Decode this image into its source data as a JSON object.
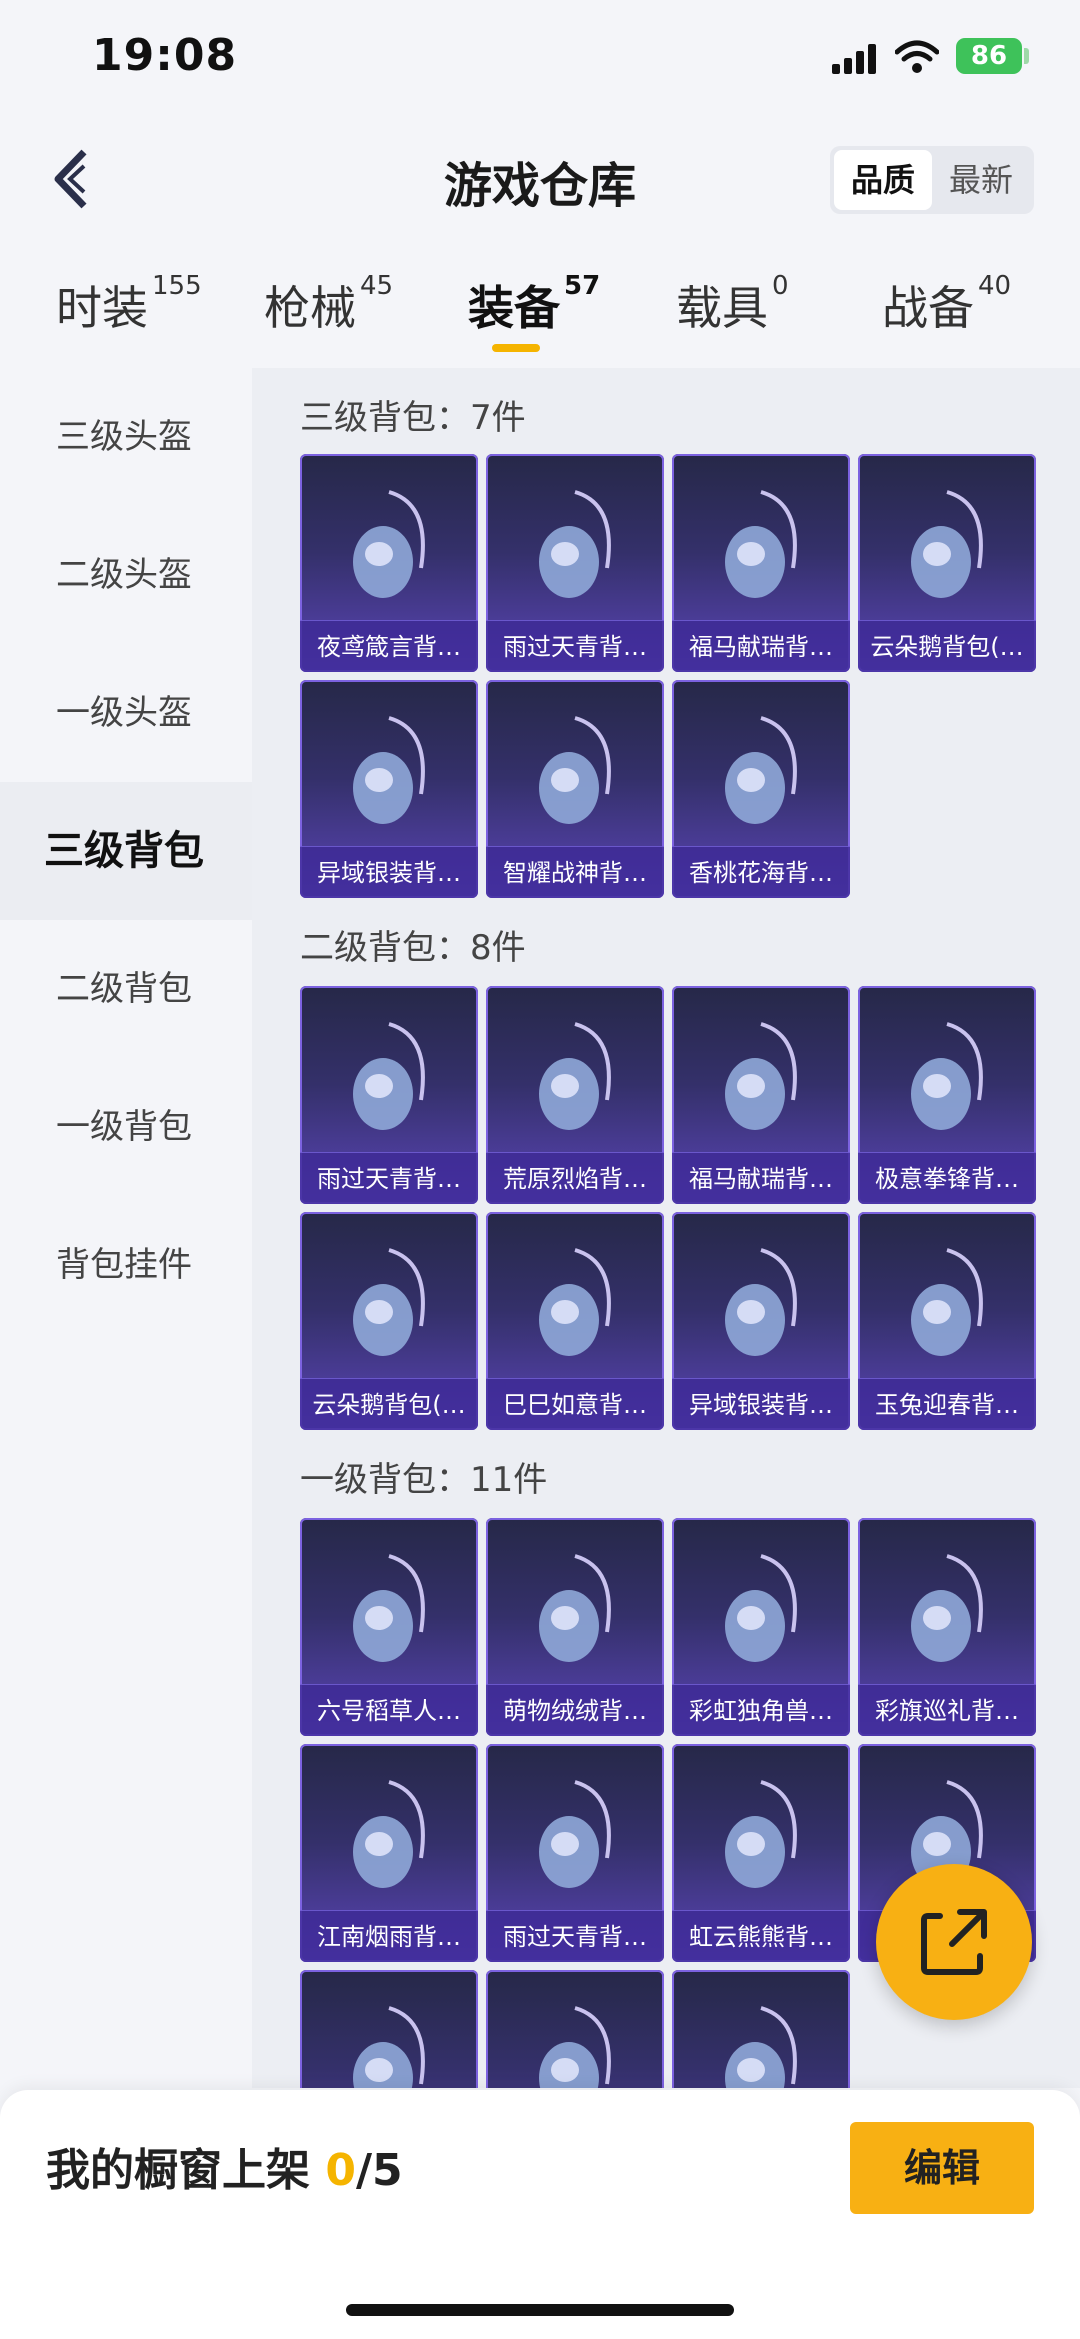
{
  "status_bar": {
    "time": "19:08",
    "battery": "86"
  },
  "header": {
    "title": "游戏仓库",
    "sort_options": [
      "品质",
      "最新"
    ]
  },
  "tabs": [
    {
      "label": "时装",
      "count": "155"
    },
    {
      "label": "枪械",
      "count": "45"
    },
    {
      "label": "装备",
      "count": "57"
    },
    {
      "label": "载具",
      "count": "0"
    },
    {
      "label": "战备",
      "count": "40"
    }
  ],
  "sidebar": {
    "items": [
      "三级头盔",
      "二级头盔",
      "一级头盔",
      "三级背包",
      "二级背包",
      "一级背包",
      "背包挂件"
    ]
  },
  "sections": [
    {
      "title": "三级背包：7件",
      "items": [
        "夜鸢箴言背…",
        "雨过天青背…",
        "福马献瑞背…",
        "云朵鹅背包(…",
        "异域银装背…",
        "智耀战神背…",
        "香桃花海背…"
      ]
    },
    {
      "title": "二级背包：8件",
      "items": [
        "雨过天青背…",
        "荒原烈焰背…",
        "福马献瑞背…",
        "极意拳锋背…",
        "云朵鹅背包(…",
        "巳巳如意背…",
        "异域银装背…",
        "玉兔迎春背…"
      ]
    },
    {
      "title": "一级背包：11件",
      "items": [
        "六号稻草人…",
        "萌物绒绒背…",
        "彩虹独角兽…",
        "彩旗巡礼背…",
        "江南烟雨背…",
        "雨过天青背…",
        "虹云熊熊背…",
        "",
        "",
        "",
        ""
      ]
    }
  ],
  "bottom": {
    "shelf_prefix": "我的橱窗上架 ",
    "shelf_current": "0",
    "shelf_total": "/5",
    "edit_label": "编辑"
  },
  "colors": {
    "accent": "#f8b013",
    "card_top": "#262848",
    "card_bottom": "#5b45b8"
  }
}
